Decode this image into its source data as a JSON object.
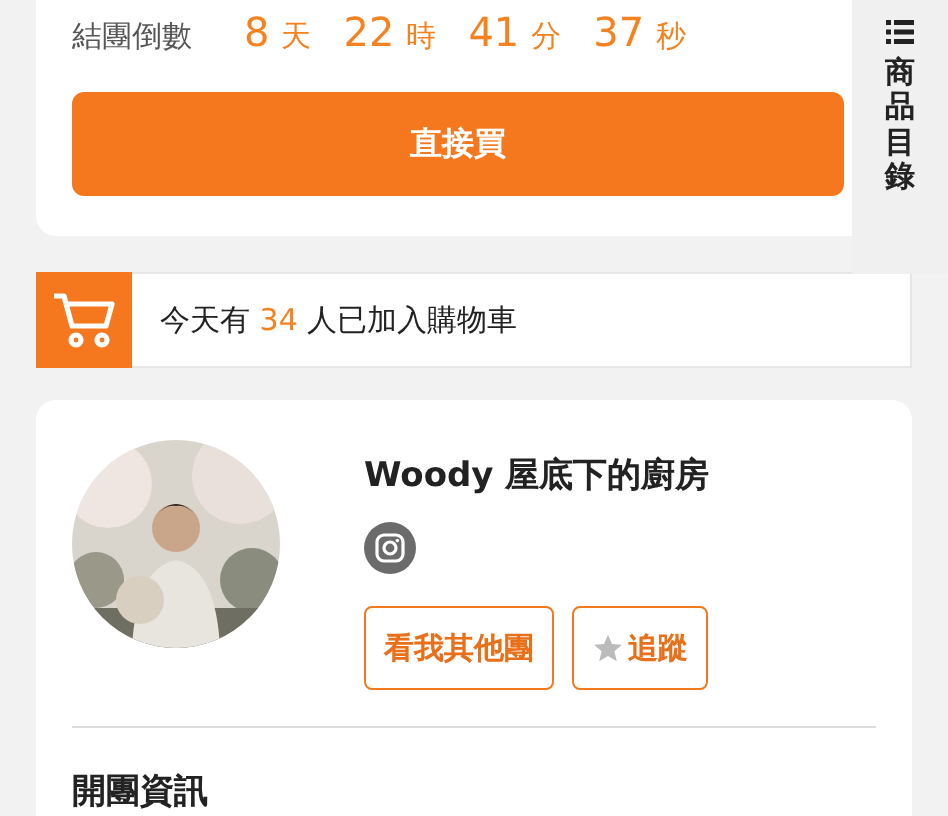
{
  "countdown": {
    "label": "結團倒數",
    "units": [
      {
        "value": "8",
        "unit": "天"
      },
      {
        "value": "22",
        "unit": "時"
      },
      {
        "value": "41",
        "unit": "分"
      },
      {
        "value": "37",
        "unit": "秒"
      }
    ]
  },
  "buy_button": "直接買",
  "catalog_tab": {
    "label": "商品目錄"
  },
  "cart_banner": {
    "prefix": "今天有",
    "count": "34",
    "suffix": "人已加入購物車"
  },
  "seller": {
    "name": "Woody 屋底下的廚房",
    "buttons": [
      {
        "label": "看我其他團",
        "kind": "plain"
      },
      {
        "label": "追蹤",
        "kind": "star"
      }
    ]
  },
  "section_title": "開團資訊"
}
